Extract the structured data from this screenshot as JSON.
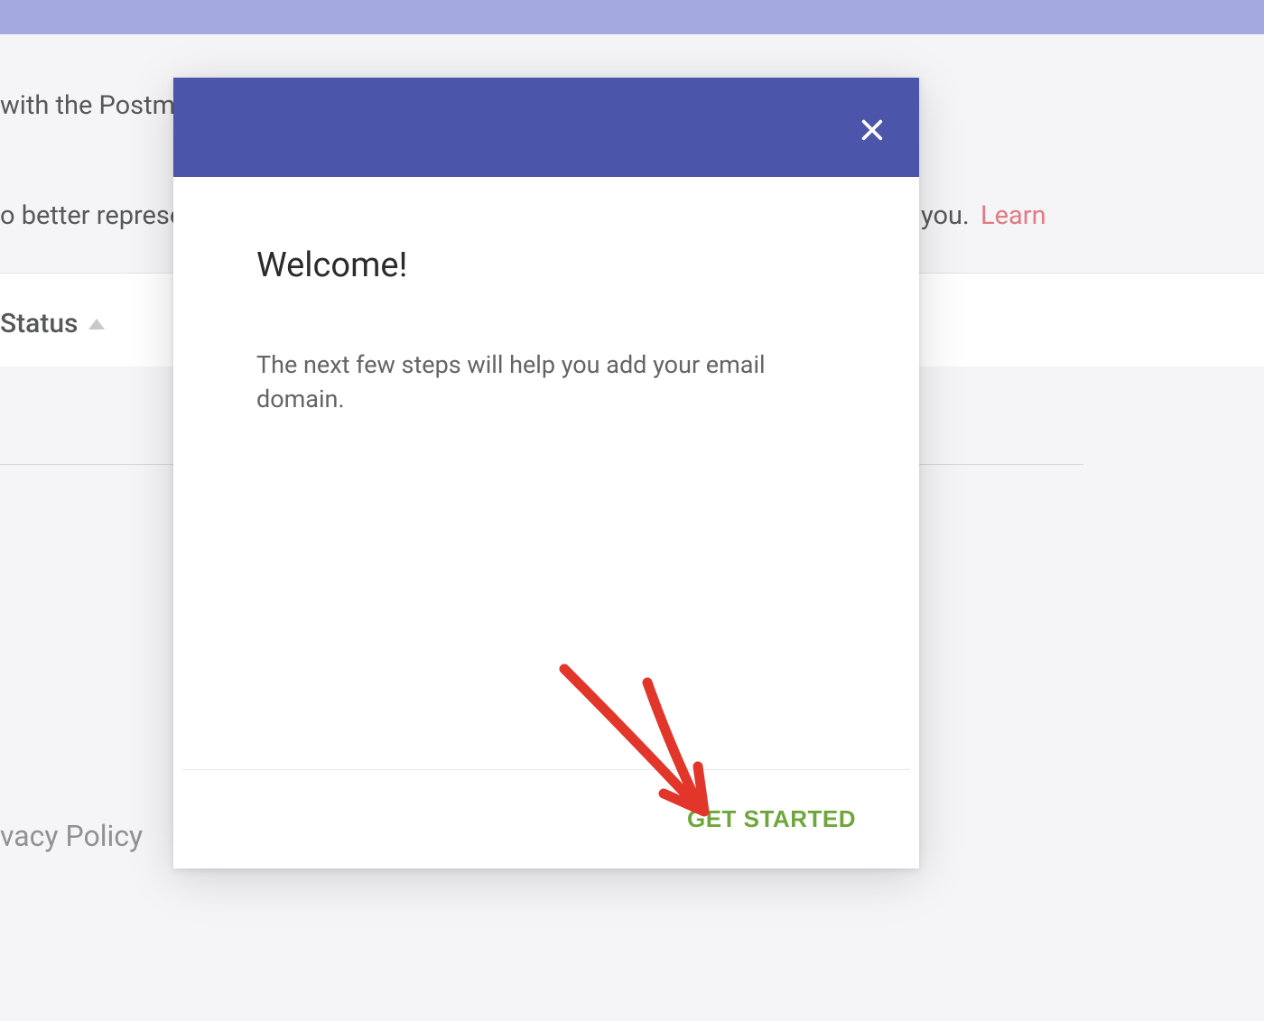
{
  "background": {
    "text_top": "with the Postma",
    "text_mid": "o better represe",
    "text_right_prefix": "you.",
    "text_learn": "Learn",
    "status_label": "Status",
    "privacy_text": "vacy Policy"
  },
  "modal": {
    "title": "Welcome!",
    "description": "The next few steps will help you add your email domain.",
    "cta_label": "GET STARTED"
  }
}
